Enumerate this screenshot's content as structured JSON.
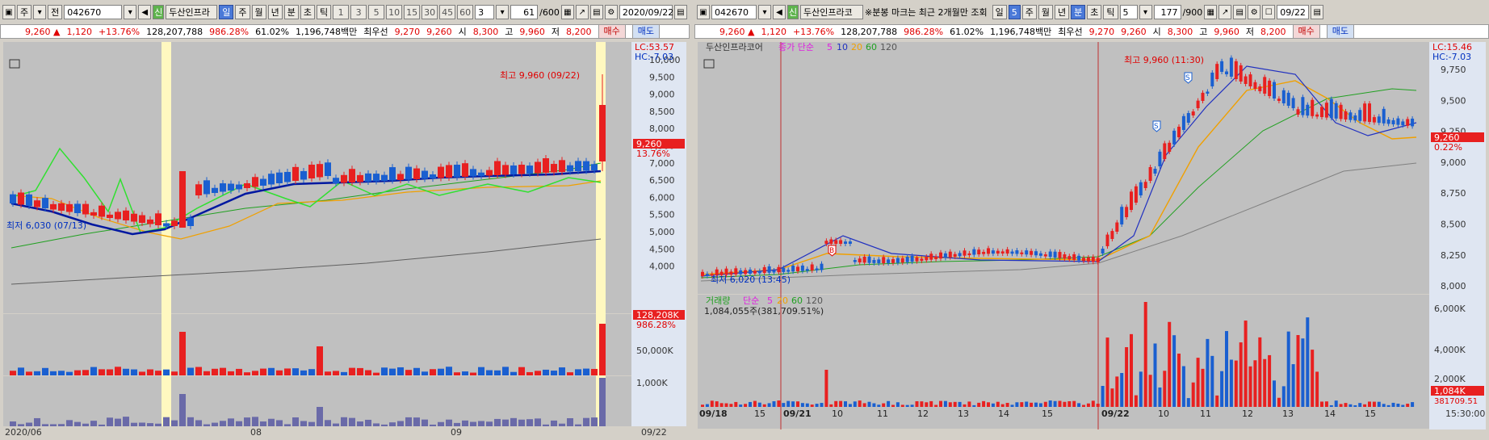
{
  "left": {
    "toolbar": {
      "period_label": "주",
      "prev_label": "전",
      "code": "042670",
      "shin_badge": "신",
      "stock_name": "두산인프라",
      "tabs": [
        "일",
        "주",
        "월",
        "년",
        "분",
        "초",
        "틱"
      ],
      "selected_tab": "일",
      "intervals": [
        "1",
        "3",
        "5",
        "10",
        "15",
        "30",
        "45",
        "60"
      ],
      "interval_value": "3",
      "count": "61",
      "count_total": "/600",
      "date": "2020/09/22"
    },
    "info": {
      "price": "9,260",
      "change": "1,120",
      "change_pct": "+13.76%",
      "volume": "128,207,788",
      "vol_pct": "986.28%",
      "rate": "61.02%",
      "amount": "1,196,748백만",
      "pref_label": "최우선",
      "bid": "9,270",
      "ask": "9,260",
      "open_label": "시",
      "open": "8,300",
      "high_label": "고",
      "high": "9,960",
      "low_label": "저",
      "low": "8,200",
      "buy_btn": "매수",
      "sell_btn": "매도"
    },
    "chart": {
      "lc": "LC:53.57",
      "hc": "HC:-7.03",
      "max_label": "최고 9,960 (09/22)",
      "min_label": "최저 6,030 (07/13)",
      "price_ticks": [
        "10,000",
        "9,500",
        "9,000",
        "8,500",
        "8,000",
        "7,500",
        "7,000",
        "6,500",
        "6,000",
        "5,500",
        "5,000",
        "4,500",
        "4,000"
      ],
      "price_box": "9,260",
      "price_pct": "13.76%",
      "vol_box": "128,208K",
      "vol_pct": "986.28%",
      "vol_tick": "50,000K",
      "sub_tick": "1,000K",
      "x_labels": [
        "2020/06",
        "08",
        "09"
      ],
      "x_right": "09/22"
    }
  },
  "right": {
    "toolbar": {
      "code": "042670",
      "shin_badge": "신",
      "stock_name": "두산인프라코",
      "notice": "※분봉 마크는 최근 2개월만 조회",
      "day_label": "일",
      "interval": "5",
      "tabs": [
        "주",
        "월",
        "년",
        "분",
        "초",
        "틱"
      ],
      "selected_tab": "분",
      "minute_value": "5",
      "count": "177",
      "count_total": "/900",
      "date": "09/22"
    },
    "info": {
      "price": "9,260",
      "change": "1,120",
      "change_pct": "+13.76%",
      "volume": "128,207,788",
      "vol_pct": "986.28%",
      "rate": "61.02%",
      "amount": "1,196,748백만",
      "pref_label": "최우선",
      "bid": "9,270",
      "ask": "9,260",
      "open_label": "시",
      "open": "8,300",
      "high_label": "고",
      "high": "9,960",
      "low_label": "저",
      "low": "8,200",
      "buy_btn": "매수",
      "sell_btn": "매도"
    },
    "chart": {
      "legend_name": "두산인프라코어",
      "legend_ma": "종가 단순",
      "ma_periods": [
        "5",
        "10",
        "20",
        "60",
        "120"
      ],
      "lc": "LC:15.46",
      "hc": "HC:-7.03",
      "max_label": "최고 9,960 (11:30)",
      "min_label": "최저 6,020 (13:45)",
      "price_ticks": [
        "9,750",
        "9,500",
        "9,250",
        "9,000",
        "8,750",
        "8,500",
        "8,250",
        "8,000"
      ],
      "price_box": "9,260",
      "price_pct": "0.22%",
      "vol_legend": "거래량",
      "vol_ma": "단순",
      "vol_periods": [
        "5",
        "20",
        "60",
        "120"
      ],
      "vol_value": "1,084,055주(381,709.51%)",
      "vol_ticks": [
        "6,000K",
        "4,000K",
        "2,000K"
      ],
      "vol_box": "1,084K",
      "vol_box2": "381709.51",
      "x_labels": [
        "09/18",
        "15",
        "09/21",
        "10",
        "11",
        "12",
        "13",
        "14",
        "15",
        "09/22",
        "10",
        "11",
        "12",
        "13",
        "14",
        "15"
      ],
      "x_right": "15:30:00",
      "markers": {
        "b": "B",
        "s": "S"
      }
    }
  },
  "colors": {
    "up": "#e82020",
    "down": "#1a5fd0",
    "ma5": "#e020e0",
    "ma20": "#f0a000",
    "ma60": "#20a020",
    "ma120": "#808080",
    "bg": "#c0c0c0",
    "highlight": "#fff8c0"
  }
}
